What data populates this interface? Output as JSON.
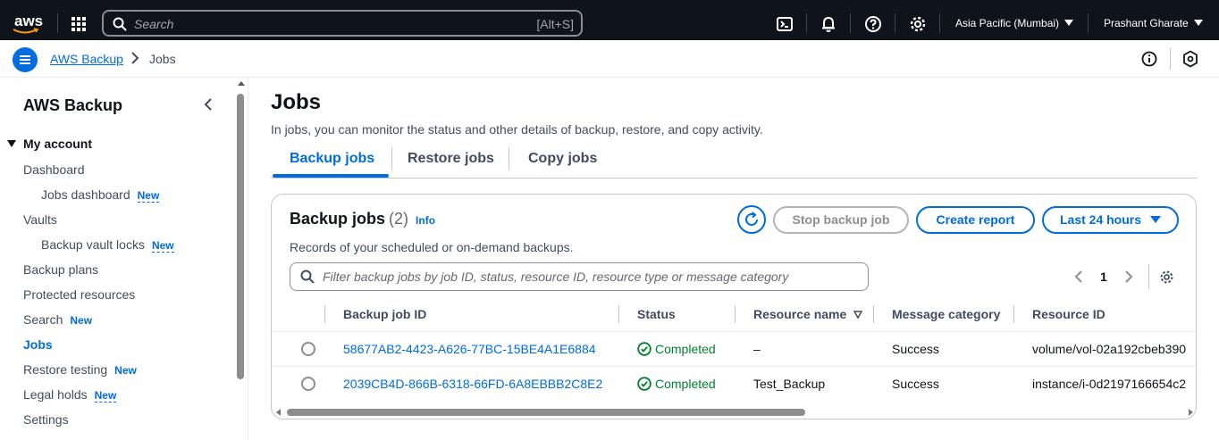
{
  "topnav": {
    "logo_text": "aws",
    "search_placeholder": "Search",
    "search_shortcut": "[Alt+S]",
    "region": "Asia Pacific (Mumbai)",
    "user": "Prashant Gharate"
  },
  "breadcrumb": {
    "items": [
      "AWS Backup",
      "Jobs"
    ]
  },
  "sidebar": {
    "title": "AWS Backup",
    "section": "My account",
    "new_label": "New",
    "items": [
      {
        "label": "Dashboard",
        "new": false,
        "sub": false,
        "active": false
      },
      {
        "label": "Jobs dashboard",
        "new": true,
        "sub": true,
        "active": false
      },
      {
        "label": "Vaults",
        "new": false,
        "sub": false,
        "active": false
      },
      {
        "label": "Backup vault locks",
        "new": true,
        "sub": true,
        "active": false
      },
      {
        "label": "Backup plans",
        "new": false,
        "sub": false,
        "active": false
      },
      {
        "label": "Protected resources",
        "new": false,
        "sub": false,
        "active": false
      },
      {
        "label": "Search",
        "new": true,
        "sub": false,
        "active": false
      },
      {
        "label": "Jobs",
        "new": false,
        "sub": false,
        "active": true
      },
      {
        "label": "Restore testing",
        "new": true,
        "sub": false,
        "active": false
      },
      {
        "label": "Legal holds",
        "new": true,
        "sub": false,
        "active": false
      },
      {
        "label": "Settings",
        "new": false,
        "sub": false,
        "active": false
      }
    ]
  },
  "page": {
    "title": "Jobs",
    "description": "In jobs, you can monitor the status and other details of backup, restore, and copy activity.",
    "tabs": [
      "Backup jobs",
      "Restore jobs",
      "Copy jobs"
    ],
    "active_tab": "Backup jobs"
  },
  "container": {
    "title": "Backup jobs",
    "count": "(2)",
    "info": "Info",
    "description": "Records of your scheduled or on-demand backups.",
    "stop_button": "Stop backup job",
    "report_button": "Create report",
    "range_button": "Last 24 hours",
    "filter_placeholder": "Filter backup jobs by job ID, status, resource ID, resource type or message category",
    "current_page": "1"
  },
  "table": {
    "columns": [
      "Backup job ID",
      "Status",
      "Resource name",
      "Message category",
      "Resource ID"
    ],
    "rows": [
      {
        "job_id": "58677AB2-4423-A626-77BC-15BE4A1E6884",
        "status": "Completed",
        "resource_name": "–",
        "message_category": "Success",
        "resource_id": "volume/vol-02a192cbeb390"
      },
      {
        "job_id": "2039CB4D-866B-6318-66FD-6A8EBBB2C8E2",
        "status": "Completed",
        "resource_name": "Test_Backup",
        "message_category": "Success",
        "resource_id": "instance/i-0d2197166654c2"
      }
    ]
  },
  "colors": {
    "accent": "#006ce0",
    "nav_bg": "#0f141a",
    "success": "#00802f"
  }
}
